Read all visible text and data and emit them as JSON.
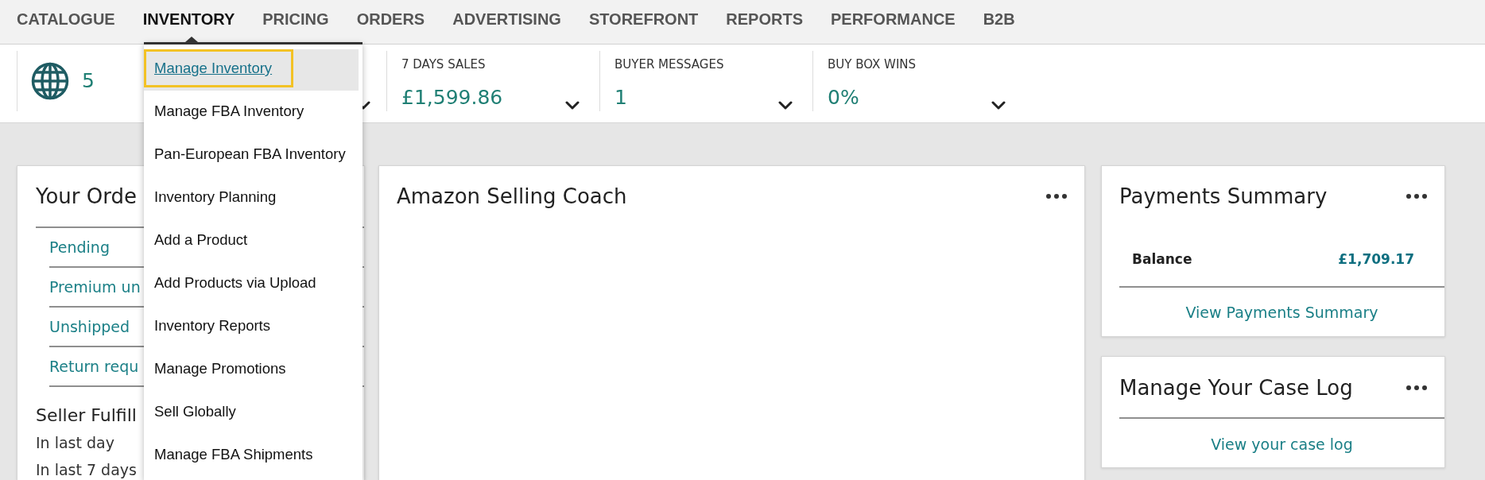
{
  "nav": {
    "tabs": [
      {
        "label": "CATALOGUE",
        "selected": false
      },
      {
        "label": "INVENTORY",
        "selected": true
      },
      {
        "label": "PRICING",
        "selected": false
      },
      {
        "label": "ORDERS",
        "selected": false
      },
      {
        "label": "ADVERTISING",
        "selected": false
      },
      {
        "label": "STOREFRONT",
        "selected": false
      },
      {
        "label": "REPORTS",
        "selected": false
      },
      {
        "label": "PERFORMANCE",
        "selected": false
      },
      {
        "label": "B2B",
        "selected": false
      }
    ]
  },
  "inventory_menu": {
    "items": [
      {
        "label": "Manage Inventory",
        "selected": true
      },
      {
        "label": "Manage FBA Inventory",
        "selected": false
      },
      {
        "label": "Pan-European FBA Inventory",
        "selected": false
      },
      {
        "label": "Inventory Planning",
        "selected": false
      },
      {
        "label": "Add a Product",
        "selected": false
      },
      {
        "label": "Add Products via Upload",
        "selected": false
      },
      {
        "label": "Inventory Reports",
        "selected": false
      },
      {
        "label": "Manage Promotions",
        "selected": false
      },
      {
        "label": "Sell Globally",
        "selected": false
      },
      {
        "label": "Manage FBA Shipments",
        "selected": false
      }
    ]
  },
  "metrics": [
    {
      "kind": "marketplaces",
      "value": "5"
    },
    {
      "kind": "stat",
      "label": "7 DAYS SALES",
      "value": "£1,599.86"
    },
    {
      "kind": "stat",
      "label": "BUYER MESSAGES",
      "value": "1"
    },
    {
      "kind": "stat",
      "label": "BUY BOX WINS",
      "value": "0%"
    }
  ],
  "cards": [
    {
      "kind": "orders",
      "title": "Your Orde",
      "links": [
        "Pending",
        "Premium un",
        "Unshipped",
        "Return requ"
      ],
      "section_title": "Seller Fulfill",
      "rows": [
        "In last day",
        "In last 7 days"
      ]
    },
    {
      "kind": "coach",
      "title": "Amazon Selling Coach",
      "menu": true
    },
    {
      "kind": "payments",
      "title": "Payments Summary",
      "menu": true,
      "balance_label": "Balance",
      "balance_value": "£1,709.17",
      "link": "View Payments Summary"
    },
    {
      "kind": "case_log",
      "title": "Manage Your Case Log",
      "menu": true,
      "link": "View your case log"
    }
  ]
}
